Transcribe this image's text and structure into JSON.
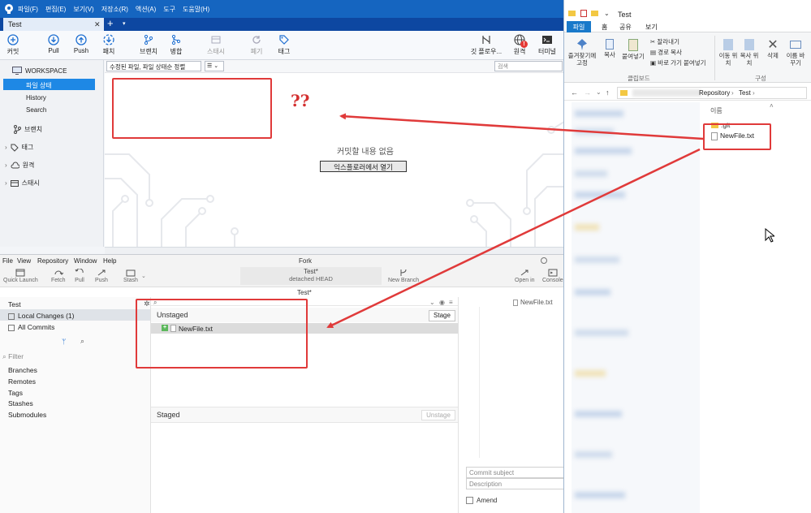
{
  "sourcetree": {
    "menu": [
      "파일(F)",
      "편집(E)",
      "보기(V)",
      "저장소(R)",
      "액션(A)",
      "도구",
      "도움말(H)"
    ],
    "tab_title": "Test",
    "tab_close": "✕",
    "tab_add": "+",
    "tab_menu": "▾",
    "toolbar": [
      "커밋",
      "Pull",
      "Push",
      "패치",
      "브랜치",
      "병합",
      "스태시",
      "폐기",
      "태그",
      "깃 플로우...",
      "원격",
      "터미널"
    ],
    "workspace_label": "WORKSPACE",
    "workspace_items": [
      "파일 상태",
      "History",
      "Search"
    ],
    "sections": [
      "브랜치",
      "태그",
      "원격",
      "스태시"
    ],
    "filter_select": "수정된 파일, 파일 상태순 정렬",
    "view_select": "☰ ⌄",
    "search_placeholder": "검색",
    "empty_message": "커밋할 내용 없음",
    "open_in_explorer": "익스플로러에서 열기",
    "remote_badge": "!"
  },
  "annotation": {
    "question": "??"
  },
  "fork": {
    "menu": [
      "File",
      "View",
      "Repository",
      "Window",
      "Help"
    ],
    "window_title": "Fork",
    "toolbar": [
      "Quick Launch",
      "Fetch",
      "Pull",
      "Push",
      "Stash",
      "New Branch",
      "Open in",
      "Console"
    ],
    "branch_box_repo": "Test*",
    "branch_box_branch": "detached HEAD",
    "repo_name": "Test*",
    "sidebar_repo": "Test",
    "local_changes": "Local Changes (1)",
    "all_commits": "All Commits",
    "filter_placeholder": "Filter",
    "nav_items": [
      "Branches",
      "Remotes",
      "Tags",
      "Stashes",
      "Submodules"
    ],
    "unstaged_label": "Unstaged",
    "stage_button": "Stage",
    "file_name": "NewFile.txt",
    "file_status_glyph": "+",
    "staged_label": "Staged",
    "unstage_button": "Unstage",
    "diff_file": "NewFile.txt",
    "commit_subject_placeholder": "Commit subject",
    "description_placeholder": "Description",
    "amend_label": "Amend"
  },
  "explorer": {
    "title": "Test",
    "ribbon_tabs": [
      "파일",
      "홈",
      "공유",
      "보기"
    ],
    "ribbon_buttons": [
      "즐겨찾기에 고정",
      "복사",
      "붙여넣기",
      "잘라내기",
      "경로 복사",
      "바로 가기 붙여넣기",
      "이동 위치",
      "복사 위치",
      "삭제",
      "이름 바꾸기"
    ],
    "group_labels": [
      "클립보드",
      "구성"
    ],
    "breadcrumb": [
      "Repository",
      "Test"
    ],
    "column_header": "이름",
    "git_folder": ".git",
    "file": "NewFile.txt"
  },
  "colors": {
    "sourcetree_titlebar": "#1565c0",
    "sourcetree_tabbar": "#0d47a1",
    "selection": "#1e88e5",
    "annotation_red": "#e03a3a",
    "explorer_file_tab": "#1979ca"
  }
}
